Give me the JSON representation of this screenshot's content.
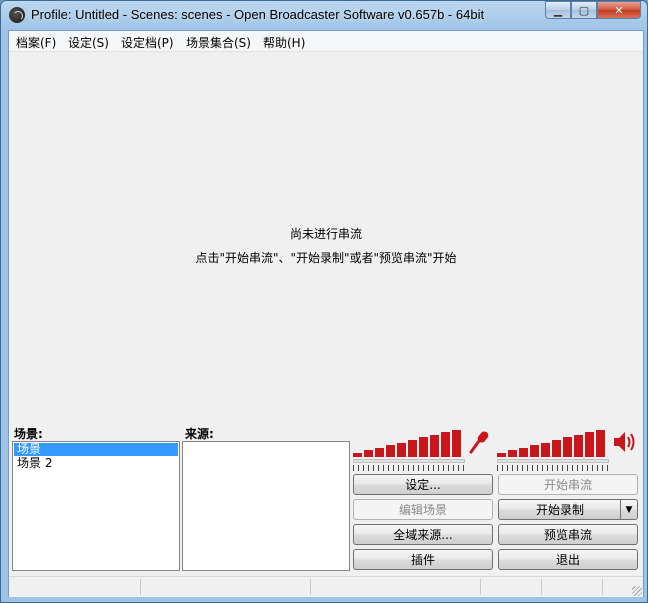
{
  "window": {
    "title": "Profile: Untitled - Scenes: scenes - Open Broadcaster Software v0.657b - 64bit",
    "minimize_glyph": "▁",
    "maximize_glyph": "▢",
    "close_glyph": "✕"
  },
  "menu": [
    "档案(F)",
    "设定(S)",
    "设定档(P)",
    "场景集合(S)",
    "帮助(H)"
  ],
  "preview": {
    "line1": "尚未进行串流",
    "line2": "点击\"开始串流\"、\"开始录制\"或者\"预览串流\"开始"
  },
  "scenes": {
    "label": "场景:",
    "items": [
      "场景",
      "场景 2"
    ],
    "selected_index": 0
  },
  "sources": {
    "label": "来源:",
    "items": []
  },
  "buttons": {
    "settings": "设定...",
    "start_stream": "开始串流",
    "edit_scene": "编辑场景",
    "start_record": "开始录制",
    "global_sources": "全域来源...",
    "preview_stream": "预览串流",
    "plugins": "插件",
    "exit": "退出",
    "dropdown_glyph": "▼"
  },
  "icons": {
    "mic": "microphone-icon",
    "speaker": "speaker-icon"
  },
  "colors": {
    "meter": "#c8161d",
    "selection": "#3399ff"
  }
}
